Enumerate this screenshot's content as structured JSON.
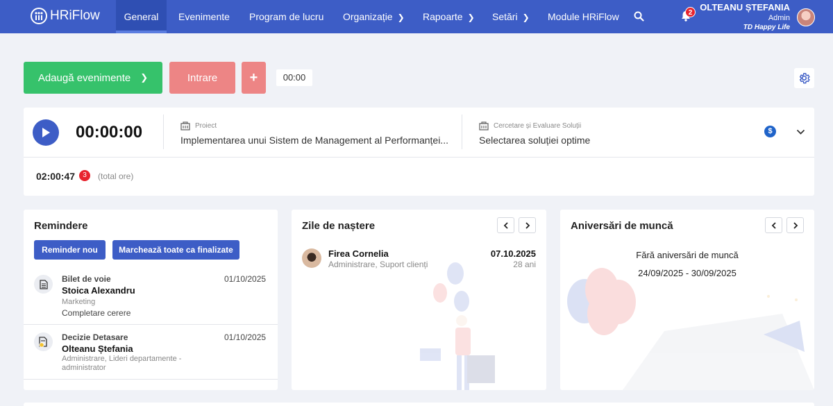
{
  "app": {
    "logo_text": "HRiFlow"
  },
  "nav": {
    "items": [
      {
        "label": "General",
        "active": true,
        "has_chevron": false
      },
      {
        "label": "Evenimente",
        "active": false,
        "has_chevron": false
      },
      {
        "label": "Program de lucru",
        "active": false,
        "has_chevron": false
      },
      {
        "label": "Organizație",
        "active": false,
        "has_chevron": true
      },
      {
        "label": "Rapoarte",
        "active": false,
        "has_chevron": true
      },
      {
        "label": "Setări",
        "active": false,
        "has_chevron": true
      },
      {
        "label": "Module HRiFlow",
        "active": false,
        "has_chevron": false
      }
    ],
    "notifications_count": "2",
    "user": {
      "name": "OLTEANU ȘTEFANIA",
      "role": "Admin",
      "company": "TD Happy Life"
    }
  },
  "actions": {
    "add_events_label": "Adaugă evenimente",
    "entry_label": "Intrare",
    "plus_label": "+",
    "small_time": "00:00"
  },
  "timer": {
    "display": "00:00:00",
    "project_label": "Proiect",
    "project_value": "Implementarea unui Sistem de Management al Performanței...",
    "activity_label": "Cercetare și Evaluare Soluții",
    "activity_value": "Selectarea soluției optime",
    "billing_symbol": "$",
    "total_time": "02:00:47",
    "total_count": "3",
    "total_label": "(total ore)"
  },
  "reminders": {
    "title": "Remindere",
    "new_button": "Reminder nou",
    "mark_all_button": "Marchează toate ca finalizate",
    "items": [
      {
        "type": "Bilet de voie",
        "date": "01/10/2025",
        "person": "Stoica Alexandru",
        "department": "Marketing",
        "status": "Completare cerere"
      },
      {
        "type": "Decizie Detasare",
        "date": "01/10/2025",
        "person": "Olteanu Ștefania",
        "department": "Administrare, Lideri departamente - administrator",
        "status": ""
      }
    ]
  },
  "birthdays": {
    "title": "Zile de naștere",
    "items": [
      {
        "name": "Firea Cornelia",
        "department": "Administrare, Suport clienți",
        "date": "07.10.2025",
        "age": "28 ani"
      }
    ]
  },
  "anniversaries": {
    "title": "Aniversări de muncă",
    "empty_text": "Fără aniversări de muncă",
    "range": "24/09/2025 - 30/09/2025"
  },
  "colors": {
    "nav_bg": "#3d5dc6",
    "add_button": "#36c26b",
    "entry_button": "#ed8585",
    "badge_red": "#e8242e",
    "primary_button": "#3d5dc6"
  },
  "icons": [
    "logo-icon",
    "chevron-right-icon",
    "search-icon",
    "bell-icon",
    "avatar",
    "gear-icon",
    "play-icon",
    "building-icon",
    "dollar-icon",
    "chevron-down-icon",
    "document-icon",
    "document-clock-icon",
    "chevron-left-icon"
  ]
}
